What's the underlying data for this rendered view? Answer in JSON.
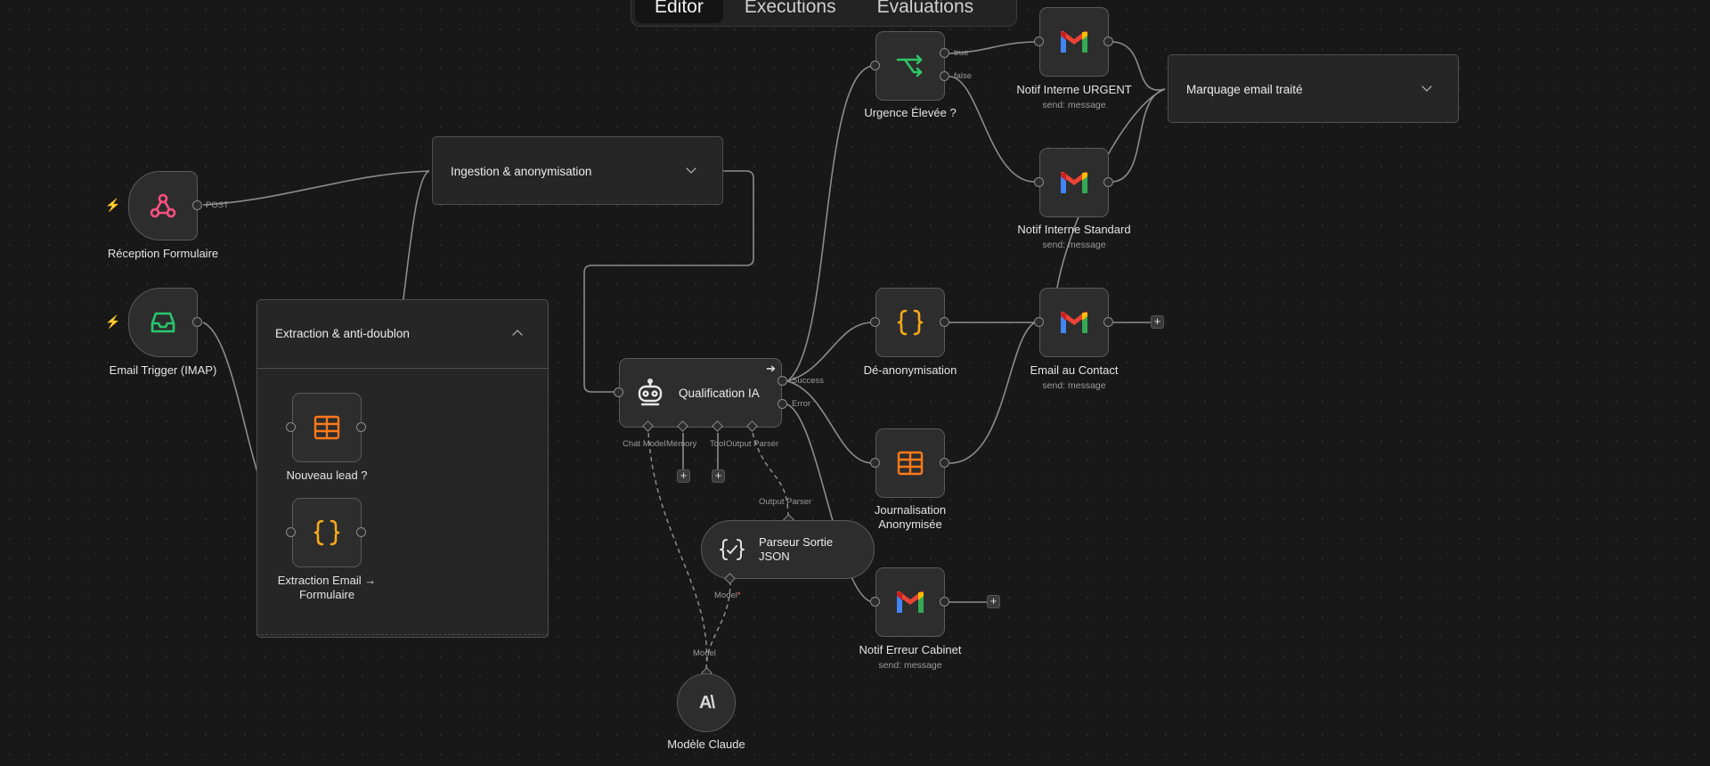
{
  "tabs": [
    {
      "label": "Editor",
      "active": true
    },
    {
      "label": "Executions",
      "active": false
    },
    {
      "label": "Evaluations",
      "active": false
    }
  ],
  "groups": {
    "ingestion": {
      "title": "Ingestion & anonymisation"
    },
    "extraction": {
      "title": "Extraction & anti-doublon"
    },
    "marquage": {
      "title": "Marquage email traité"
    }
  },
  "nodes": {
    "reception": {
      "label": "Réception Formulaire",
      "icon": "webhook-icon",
      "port": "POST"
    },
    "email_trigger": {
      "label": "Email Trigger (IMAP)",
      "icon": "inbox-icon"
    },
    "nouveau_lead": {
      "label": "Nouveau lead ?",
      "icon": "sheets-icon"
    },
    "extraction_email": {
      "label": "Extraction Email → Formulaire",
      "icon": "code-braces-icon"
    },
    "qualification": {
      "label": "Qualification IA",
      "icon": "robot-icon",
      "outputs": [
        "Success",
        "Error"
      ],
      "inputs": [
        "Chat Model",
        "Memory",
        "Tool",
        "Output Parser"
      ]
    },
    "parseur": {
      "label": "Parseur Sortie JSON",
      "icon": "json-parser-icon",
      "top_port": "Output Parser",
      "bottom_port": "Model",
      "required_mark": "*"
    },
    "modele": {
      "label": "Modèle Claude",
      "icon": "anthropic-icon",
      "port": "Model",
      "logo_text": "A\\"
    },
    "urgence": {
      "label": "Urgence Élevée ?",
      "icon": "if-branch-icon",
      "outputs": [
        "true",
        "false"
      ]
    },
    "deanon": {
      "label": "Dé-anonymisation",
      "icon": "code-braces-icon"
    },
    "journalisation": {
      "label": "Journalisation Anonymisée",
      "icon": "sheets-icon"
    },
    "notif_urgent": {
      "label": "Notif Interne URGENT",
      "sub": "send: message",
      "icon": "gmail-icon"
    },
    "notif_standard": {
      "label": "Notif Interne Standard",
      "sub": "send: message",
      "icon": "gmail-icon"
    },
    "email_contact": {
      "label": "Email au Contact",
      "sub": "send: message",
      "icon": "gmail-icon"
    },
    "notif_erreur": {
      "label": "Notif Erreur Cabinet",
      "sub": "send: message",
      "icon": "gmail-icon"
    }
  },
  "plus_label": "+",
  "colors": {
    "accent_orange": "#ff6d2e",
    "webhook_pink": "#ff4f81",
    "inbox_green": "#28c76f",
    "sheets_orange": "#ff7a1a",
    "braces_orange": "#f6a91b",
    "if_green": "#2ec866"
  }
}
